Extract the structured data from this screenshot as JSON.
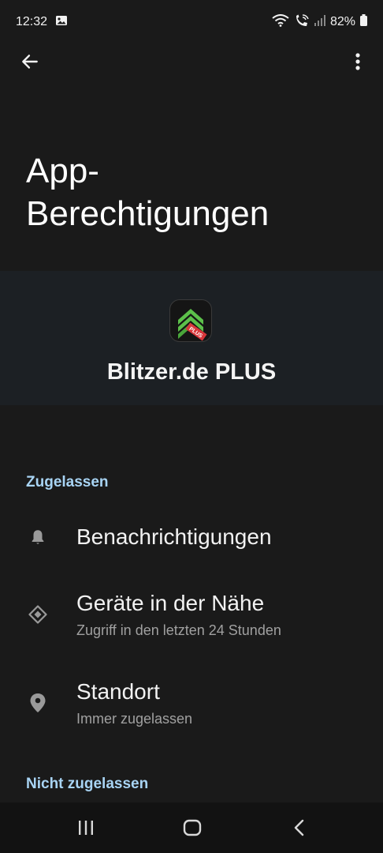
{
  "status_bar": {
    "time": "12:32",
    "battery": "82%",
    "icons": [
      "image-icon",
      "wifi-icon",
      "wifi-calling-icon",
      "signal-icon",
      "battery-icon"
    ]
  },
  "app_bar": {
    "back_icon": "arrow-back-icon",
    "more_icon": "more-vert-icon"
  },
  "page": {
    "title_line1": "App-",
    "title_line2": "Berechtigungen"
  },
  "app": {
    "name": "Blitzer.de PLUS",
    "icon_badge": "PLUS",
    "icon_colors": {
      "chevron": "#5cc04a",
      "badge": "#d8363a"
    }
  },
  "sections": {
    "allowed": {
      "header": "Zugelassen",
      "items": [
        {
          "title": "Benachrichtigungen",
          "subtitle": "",
          "icon": "bell-icon"
        },
        {
          "title": "Geräte in der Nähe",
          "subtitle": "Zugriff in den letzten 24 Stunden",
          "icon": "nearby-devices-icon"
        },
        {
          "title": "Standort",
          "subtitle": "Immer zugelassen",
          "icon": "location-pin-icon"
        }
      ]
    },
    "not_allowed": {
      "header": "Nicht zugelassen"
    }
  },
  "nav_bar": {
    "buttons": [
      "recents-icon",
      "home-icon",
      "back-nav-icon"
    ]
  },
  "colors": {
    "background": "#1a1a1a",
    "header_band": "#1c2024",
    "accent": "#a8d4f4",
    "secondary_text": "#a0a0a0"
  }
}
